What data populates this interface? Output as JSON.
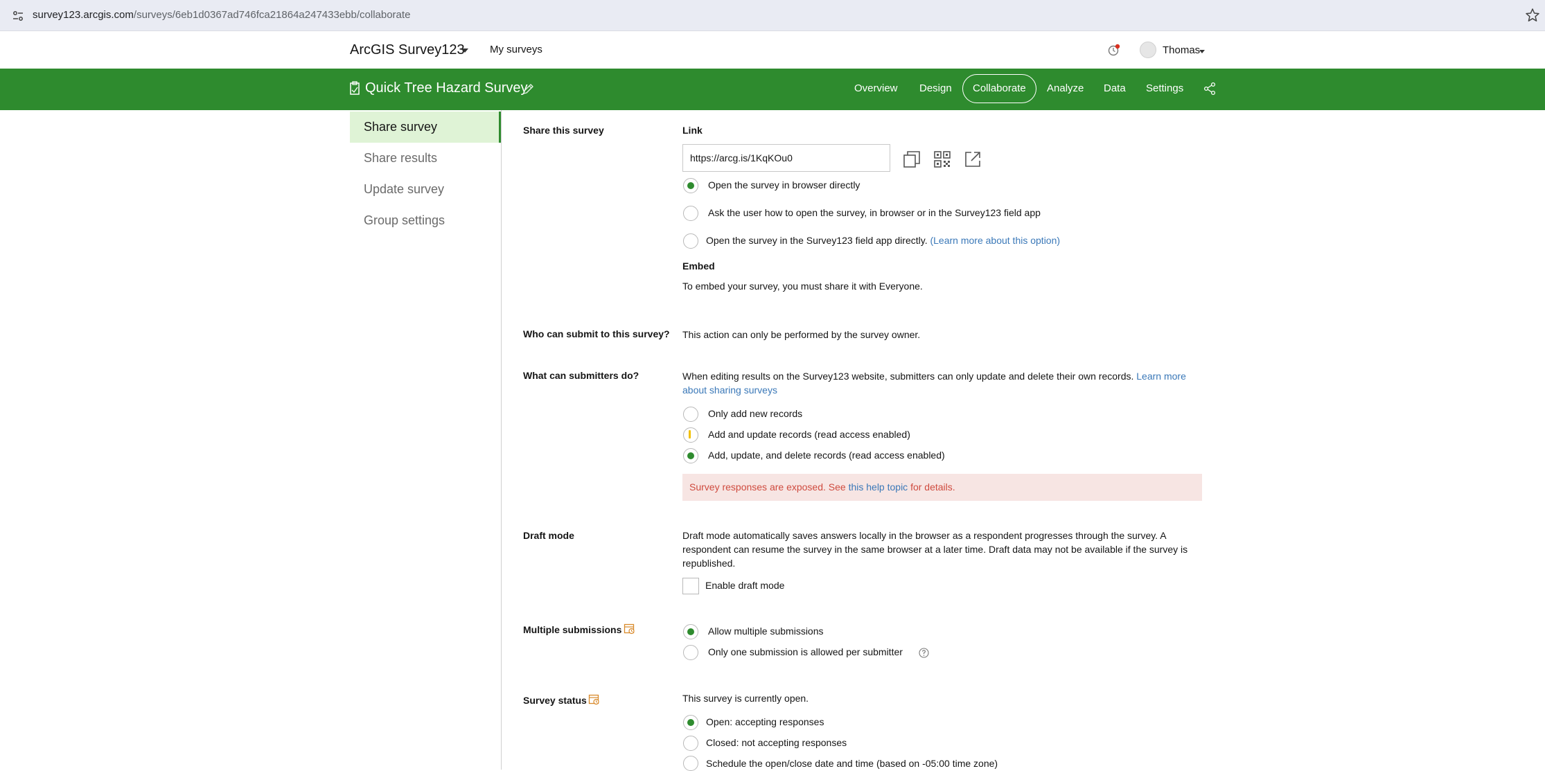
{
  "browser": {
    "url_host": "survey123.arcgis.com",
    "url_path": "/surveys/6eb1d0367ad746fca21864a247433ebb/collaborate",
    "site_info_icon": "site-settings-icon",
    "bookmark_icon": "star-icon"
  },
  "header": {
    "app_title": "ArcGIS Survey123",
    "my_surveys": "My surveys",
    "user_name": "Thomas"
  },
  "survey_bar": {
    "title": "Quick Tree Hazard Survey",
    "tabs": [
      {
        "label": "Overview",
        "active": false
      },
      {
        "label": "Design",
        "active": false
      },
      {
        "label": "Collaborate",
        "active": true
      },
      {
        "label": "Analyze",
        "active": false
      },
      {
        "label": "Data",
        "active": false
      },
      {
        "label": "Settings",
        "active": false
      }
    ],
    "color": "#2e8b2e"
  },
  "sidebar": {
    "items": [
      {
        "label": "Share survey",
        "active": true
      },
      {
        "label": "Share results",
        "active": false
      },
      {
        "label": "Update survey",
        "active": false
      },
      {
        "label": "Group settings",
        "active": false
      }
    ]
  },
  "share": {
    "section_label": "Share this survey",
    "link_heading": "Link",
    "link_value": "https://arcg.is/1KqKOu0",
    "open_options": [
      {
        "label": "Open the survey in browser directly",
        "checked": true
      },
      {
        "label": "Ask the user how to open the survey, in browser or in the Survey123 field app",
        "checked": false
      },
      {
        "label": "Open the survey in the Survey123 field app directly.",
        "checked": false,
        "link": "(Learn more about this option)"
      }
    ],
    "embed_heading": "Embed",
    "embed_text": "To embed your survey, you must share it with Everyone."
  },
  "who_submit": {
    "label": "Who can submit to this survey?",
    "text": "This action can only be performed by the survey owner."
  },
  "submitters": {
    "label": "What can submitters do?",
    "text": "When editing results on the Survey123 website, submitters can only update and delete their own records.",
    "link": "Learn more about sharing surveys",
    "options": [
      {
        "label": "Only add new records",
        "checked": false
      },
      {
        "label": "Add and update records (read access enabled)",
        "checked": false,
        "warning": true
      },
      {
        "label": "Add, update, and delete records (read access enabled)",
        "checked": true
      }
    ],
    "alert_prefix": "Survey responses are exposed. See ",
    "alert_link": "this help topic",
    "alert_suffix": " for details.",
    "alert_color": "#cf4a3e"
  },
  "draft": {
    "label": "Draft mode",
    "text": "Draft mode automatically saves answers locally in the browser as a respondent progresses through the survey. A respondent can resume the survey in the same browser at a later time. Draft data may not be available if the survey is republished.",
    "checkbox_label": "Enable draft mode",
    "checked": false
  },
  "multiple": {
    "label": "Multiple submissions",
    "options": [
      {
        "label": "Allow multiple submissions",
        "checked": true
      },
      {
        "label": "Only one submission is allowed per submitter",
        "checked": false
      }
    ]
  },
  "status": {
    "label": "Survey status",
    "text": "This survey is currently open.",
    "options": [
      {
        "label": "Open: accepting responses",
        "checked": true
      },
      {
        "label": "Closed: not accepting responses",
        "checked": false
      },
      {
        "label": "Schedule the open/close date and time (based on -05:00 time zone)",
        "checked": false
      }
    ]
  }
}
